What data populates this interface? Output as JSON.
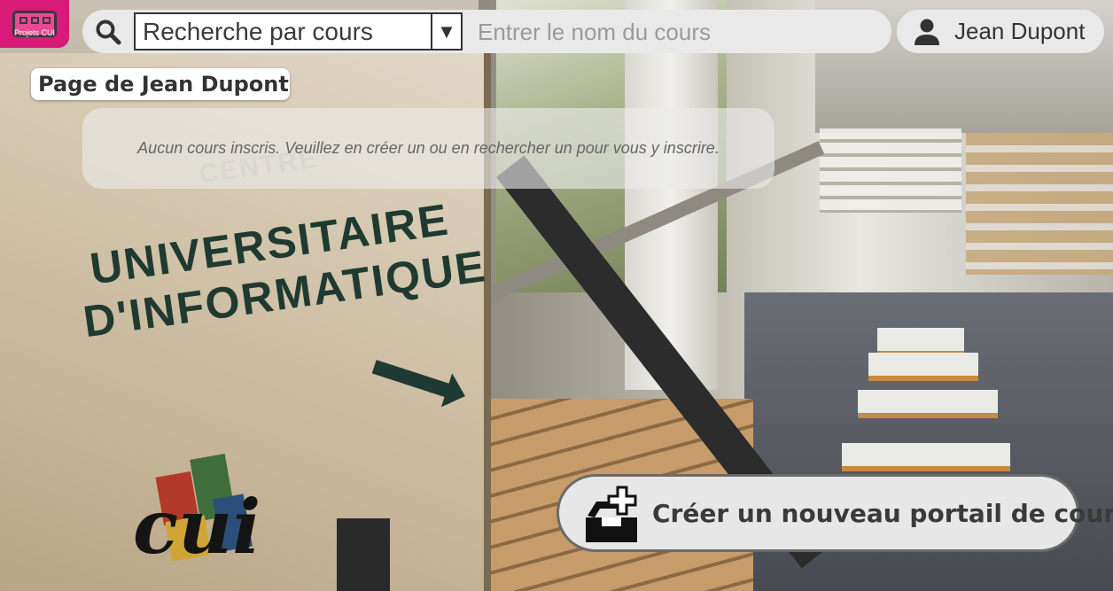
{
  "app": {
    "logo_label": "Projets CUI"
  },
  "search": {
    "mode_selected": "Recherche par cours",
    "placeholder": "Entrer le nom du cours"
  },
  "user": {
    "name": "Jean Dupont"
  },
  "page": {
    "title": "Page de Jean Dupont",
    "empty_message": "Aucun cours inscris. Veuillez en créer un ou en rechercher un pour vous y inscrire."
  },
  "actions": {
    "create_portal_label": "Créer un nouveau portail de cours"
  },
  "background": {
    "sign_line_1": "CENTRE",
    "sign_line_2": "UNIVERSITAIRE",
    "sign_line_3": "D'INFORMATIQUE",
    "sign_logo_text": "cui"
  },
  "colors": {
    "brand": "#d81b78",
    "bar_bg": "#e9e9e9"
  }
}
